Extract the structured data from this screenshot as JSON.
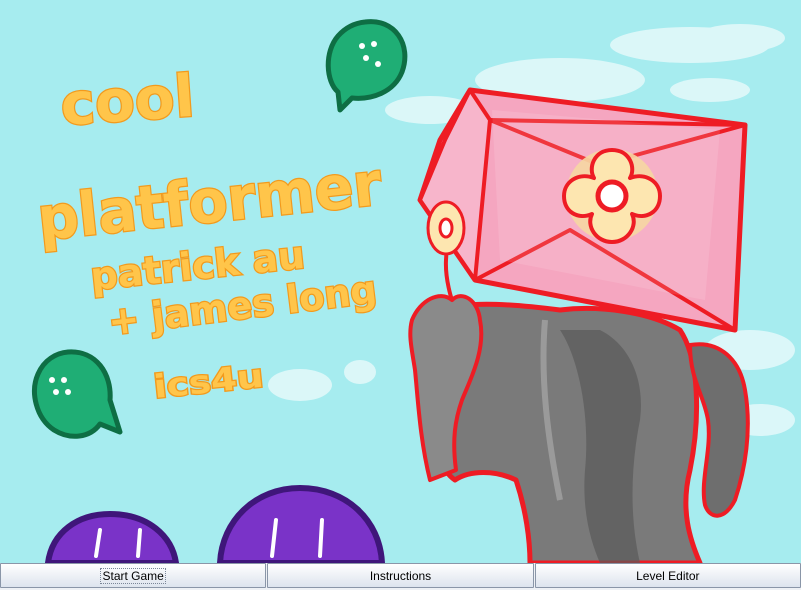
{
  "title_art": {
    "line1": "cool",
    "line2": "platformer",
    "line3": "patrick au",
    "line4": "+ james long",
    "line5": "ics4u"
  },
  "colors": {
    "sky": "#a6ecef",
    "title_fill": "#ffc54a",
    "title_outline": "#f29a1d",
    "character_outline": "#ee1c24",
    "box_pink": "#f5a6c0",
    "body_gray": "#727272",
    "slime_green": "#1fae75",
    "slime_purple": "#7a33c8"
  },
  "menu": {
    "start_label": "Start Game",
    "instructions_label": "Instructions",
    "editor_label": "Level Editor"
  }
}
